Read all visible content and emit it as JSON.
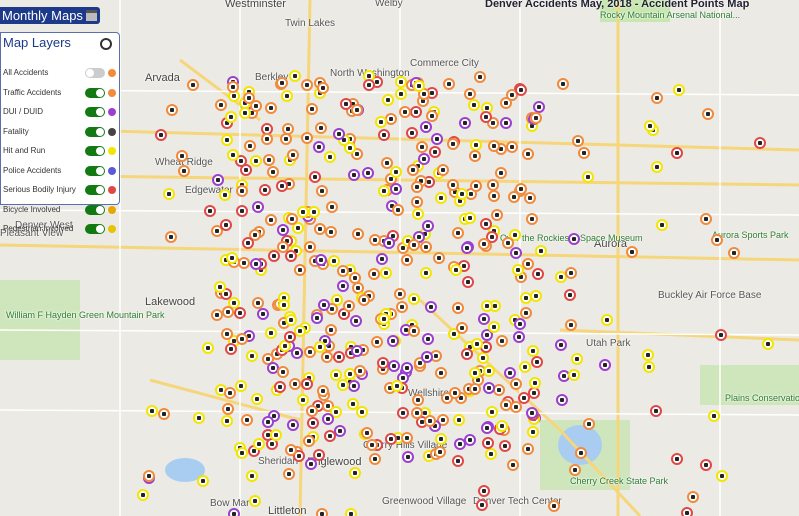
{
  "header": {
    "title": "Monthly Maps",
    "icon": "calendar-icon"
  },
  "map_title": "Denver Accidents May, 2018 - Accident Points Map",
  "panel": {
    "title": "Map Layers",
    "icon": "location-icon",
    "layers": [
      {
        "label": "All Accidents",
        "on": false,
        "color": "#f08a3c"
      },
      {
        "label": "Traffic Accidents",
        "on": true,
        "color": "#f08a3c"
      },
      {
        "label": "DUI / DUID",
        "on": true,
        "color": "#9b3fcf"
      },
      {
        "label": "Fatality",
        "on": true,
        "color": "#444444"
      },
      {
        "label": "Hit and Run",
        "on": true,
        "color": "#f2e600"
      },
      {
        "label": "Police Accidents",
        "on": true,
        "color": "#5a5ad8"
      },
      {
        "label": "Serious Bodily Injury",
        "on": true,
        "color": "#e04848"
      },
      {
        "label": "Bicycle Involved",
        "on": true,
        "color": "#e3a800"
      },
      {
        "label": "Pedestrian Involved",
        "on": true,
        "color": "#e8c400"
      }
    ]
  },
  "places": [
    {
      "name": "Westminster",
      "cls": "big"
    },
    {
      "name": "Twin Lakes",
      "cls": ""
    },
    {
      "name": "Welby",
      "cls": ""
    },
    {
      "name": "Arvada",
      "cls": "big"
    },
    {
      "name": "Berkley",
      "cls": ""
    },
    {
      "name": "North Washington",
      "cls": ""
    },
    {
      "name": "Commerce City",
      "cls": ""
    },
    {
      "name": "Wheat Ridge",
      "cls": ""
    },
    {
      "name": "Edgewater",
      "cls": ""
    },
    {
      "name": "Lakewood",
      "cls": "big"
    },
    {
      "name": "Aurora",
      "cls": "big"
    },
    {
      "name": "Aurora Sports Park",
      "cls": "park"
    },
    {
      "name": "Buckley Air Force Base",
      "cls": ""
    },
    {
      "name": "Plains Conservation Center",
      "cls": "park"
    },
    {
      "name": "Englewood",
      "cls": "big"
    },
    {
      "name": "Cherry Hills Village",
      "cls": ""
    },
    {
      "name": "Sheridan",
      "cls": ""
    },
    {
      "name": "Bow Mar",
      "cls": ""
    },
    {
      "name": "Littleton",
      "cls": "big"
    },
    {
      "name": "Greenwood Village",
      "cls": ""
    },
    {
      "name": "Cherry Creek State Park",
      "cls": "park"
    },
    {
      "name": "Wellshire",
      "cls": ""
    },
    {
      "name": "Over the Rockies & Space Museum",
      "cls": "park"
    },
    {
      "name": "Utah Park",
      "cls": ""
    },
    {
      "name": "Denver Tech Center",
      "cls": ""
    },
    {
      "name": "William F Hayden Green Mountain Park",
      "cls": "park"
    },
    {
      "name": "Pleasant View",
      "cls": ""
    },
    {
      "name": "Denver West",
      "cls": ""
    },
    {
      "name": "Rocky Mountain Arsenal National...",
      "cls": "park"
    }
  ]
}
